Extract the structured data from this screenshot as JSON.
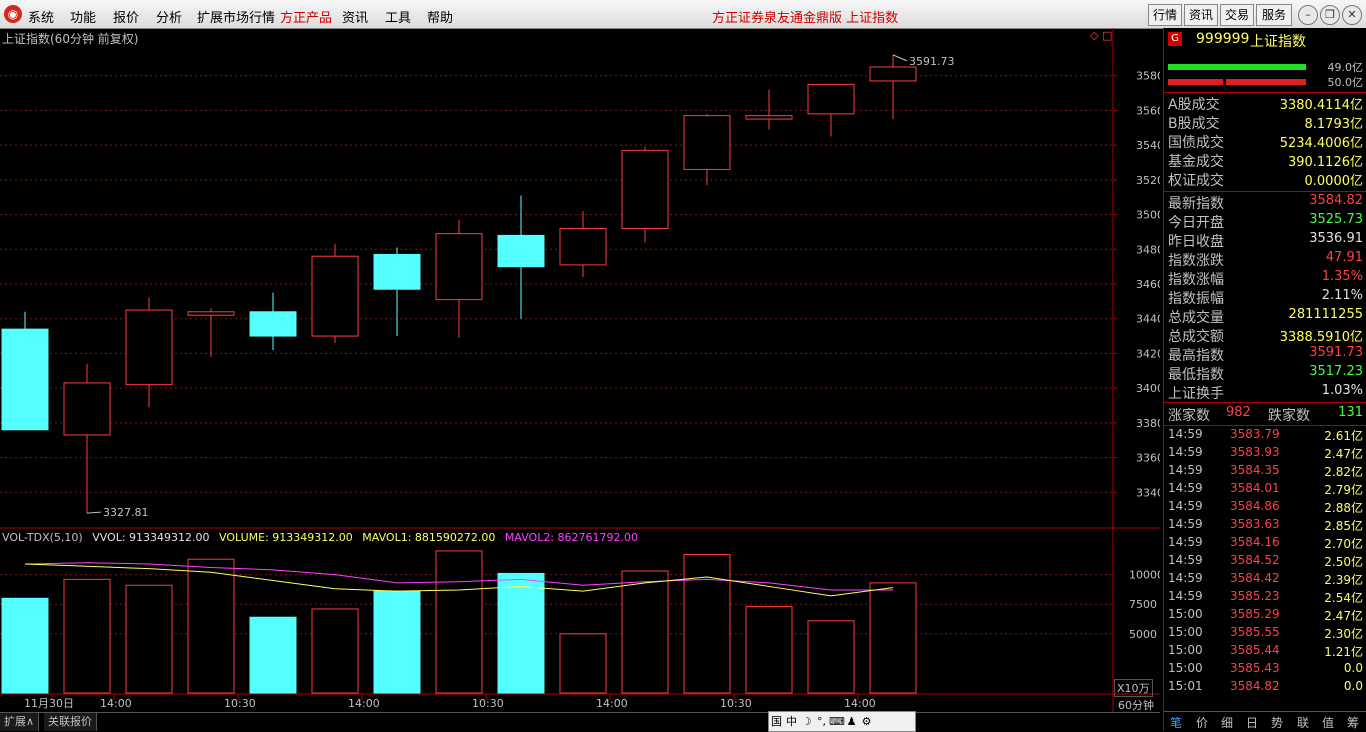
{
  "menu": {
    "items": [
      "系统",
      "功能",
      "报价",
      "分析",
      "扩展市场行情",
      "方正产品",
      "资讯",
      "工具",
      "帮助"
    ],
    "center_title": "方正证券泉友通金鼎版   上证指数",
    "right_buttons": [
      "行情",
      "资讯",
      "交易",
      "服务"
    ]
  },
  "chart": {
    "title": "上证指数(60分钟 前复权)",
    "high_label": "3591.73",
    "low_label": "3327.81",
    "vol_legend": {
      "name": "VOL-TDX(5,10)",
      "vvol": "VVOL: 913349312.00",
      "volume": "VOLUME: 913349312.00",
      "mavol1": "MAVOL1: 881590272.00",
      "mavol2": "MAVOL2: 862761792.00"
    },
    "vol_unit": "X10万",
    "period": "60分钟",
    "x_labels": [
      "11月30日",
      "14:00",
      "10:30",
      "14:00",
      "10:30",
      "14:00",
      "10:30",
      "14:00"
    ],
    "colors": {
      "up": "#ff3c3c",
      "down": "#54ffff",
      "mavol1": "#ffff60",
      "mavol2": "#ff40ff",
      "grid": "#7a1a1a"
    }
  },
  "chart_data": [
    {
      "type": "candlestick",
      "title": "上证指数(60分钟 前复权)",
      "ylim": [
        3320,
        3600
      ],
      "yticks": [
        3340,
        3360,
        3380,
        3400,
        3420,
        3440,
        3460,
        3480,
        3500,
        3520,
        3540,
        3560,
        3580
      ],
      "candles": [
        {
          "open": 3434,
          "close": 3376,
          "high": 3444,
          "low": 3376
        },
        {
          "open": 3373,
          "close": 3403,
          "high": 3414,
          "low": 3328
        },
        {
          "open": 3402,
          "close": 3445,
          "high": 3452,
          "low": 3389
        },
        {
          "open": 3442,
          "close": 3444,
          "high": 3446,
          "low": 3418
        },
        {
          "open": 3444,
          "close": 3430,
          "high": 3455,
          "low": 3422
        },
        {
          "open": 3430,
          "close": 3476,
          "high": 3483,
          "low": 3426
        },
        {
          "open": 3477,
          "close": 3457,
          "high": 3481,
          "low": 3430
        },
        {
          "open": 3451,
          "close": 3489,
          "high": 3497,
          "low": 3429
        },
        {
          "open": 3488,
          "close": 3470,
          "high": 3511,
          "low": 3440
        },
        {
          "open": 3471,
          "close": 3492,
          "high": 3502,
          "low": 3464
        },
        {
          "open": 3492,
          "close": 3537,
          "high": 3539,
          "low": 3484
        },
        {
          "open": 3526,
          "close": 3557,
          "high": 3558,
          "low": 3517
        },
        {
          "open": 3555,
          "close": 3557,
          "high": 3572,
          "low": 3549
        },
        {
          "open": 3558,
          "close": 3575,
          "high": 3575,
          "low": 3545
        },
        {
          "open": 3577,
          "close": 3585,
          "high": 3592,
          "low": 3555
        }
      ]
    },
    {
      "type": "bar",
      "title": "VOL-TDX(5,10)",
      "ylim": [
        0,
        12500
      ],
      "yticks": [
        5000,
        7500,
        10000
      ],
      "values": [
        8000,
        9600,
        9100,
        11300,
        6400,
        7100,
        8600,
        12000,
        10100,
        5000,
        10300,
        11700,
        7300,
        6100,
        9300
      ],
      "mavol1": [
        10900,
        10700,
        10500,
        10200,
        9500,
        8800,
        8600,
        8700,
        9000,
        8600,
        9300,
        9800,
        9000,
        8200,
        8900
      ],
      "mavol2": [
        10900,
        11000,
        10900,
        10600,
        10400,
        10000,
        9300,
        9400,
        9600,
        9100,
        9400,
        9600,
        9300,
        8700,
        8700
      ]
    }
  ],
  "right_panel": {
    "code": "999999",
    "name": "上证指数",
    "bar1_value": "49.0亿",
    "bar2_value": "50.0亿",
    "turnover": [
      {
        "label": "A股成交",
        "value": "3380.4114亿"
      },
      {
        "label": "B股成交",
        "value": "8.1793亿"
      },
      {
        "label": "国债成交",
        "value": "5234.4006亿"
      },
      {
        "label": "基金成交",
        "value": "390.1126亿"
      },
      {
        "label": "权证成交",
        "value": "0.0000亿"
      }
    ],
    "stats": [
      {
        "label": "最新指数",
        "value": "3584.82",
        "color": "red"
      },
      {
        "label": "今日开盘",
        "value": "3525.73",
        "color": "green"
      },
      {
        "label": "昨日收盘",
        "value": "3536.91",
        "color": "white"
      },
      {
        "label": "指数涨跌",
        "value": "47.91",
        "color": "red"
      },
      {
        "label": "指数涨幅",
        "value": "1.35%",
        "color": "red"
      },
      {
        "label": "指数振幅",
        "value": "2.11%",
        "color": "white"
      },
      {
        "label": "总成交量",
        "value": "281111255",
        "color": "yellow"
      },
      {
        "label": "总成交额",
        "value": "3388.5910亿",
        "color": "yellow"
      },
      {
        "label": "最高指数",
        "value": "3591.73",
        "color": "red"
      },
      {
        "label": "最低指数",
        "value": "3517.23",
        "color": "green"
      },
      {
        "label": "上证换手",
        "value": "1.03%",
        "color": "white"
      }
    ],
    "up_label": "涨家数",
    "up_count": "982",
    "down_label": "跌家数",
    "down_count": "131",
    "ticks": [
      {
        "time": "14:59",
        "price": "3583.79",
        "vol": "2.61亿"
      },
      {
        "time": "14:59",
        "price": "3583.93",
        "vol": "2.47亿"
      },
      {
        "time": "14:59",
        "price": "3584.35",
        "vol": "2.82亿"
      },
      {
        "time": "14:59",
        "price": "3584.01",
        "vol": "2.79亿"
      },
      {
        "time": "14:59",
        "price": "3584.86",
        "vol": "2.88亿"
      },
      {
        "time": "14:59",
        "price": "3583.63",
        "vol": "2.85亿"
      },
      {
        "time": "14:59",
        "price": "3584.16",
        "vol": "2.70亿"
      },
      {
        "time": "14:59",
        "price": "3584.52",
        "vol": "2.50亿"
      },
      {
        "time": "14:59",
        "price": "3584.42",
        "vol": "2.39亿"
      },
      {
        "time": "14:59",
        "price": "3585.23",
        "vol": "2.54亿"
      },
      {
        "time": "15:00",
        "price": "3585.29",
        "vol": "2.47亿"
      },
      {
        "time": "15:00",
        "price": "3585.55",
        "vol": "2.30亿"
      },
      {
        "time": "15:00",
        "price": "3585.44",
        "vol": "1.21亿"
      },
      {
        "time": "15:00",
        "price": "3585.43",
        "vol": "0.0"
      },
      {
        "time": "15:01",
        "price": "3584.82",
        "vol": "0.0"
      }
    ],
    "tabs": [
      "笔",
      "价",
      "细",
      "日",
      "势",
      "联",
      "值",
      "筹"
    ]
  },
  "bottom": {
    "buttons": [
      "扩展∧",
      "关联报价"
    ],
    "tools": [
      "国",
      "中",
      "☽",
      "°,",
      "⌨",
      "♟",
      "⚙"
    ]
  }
}
